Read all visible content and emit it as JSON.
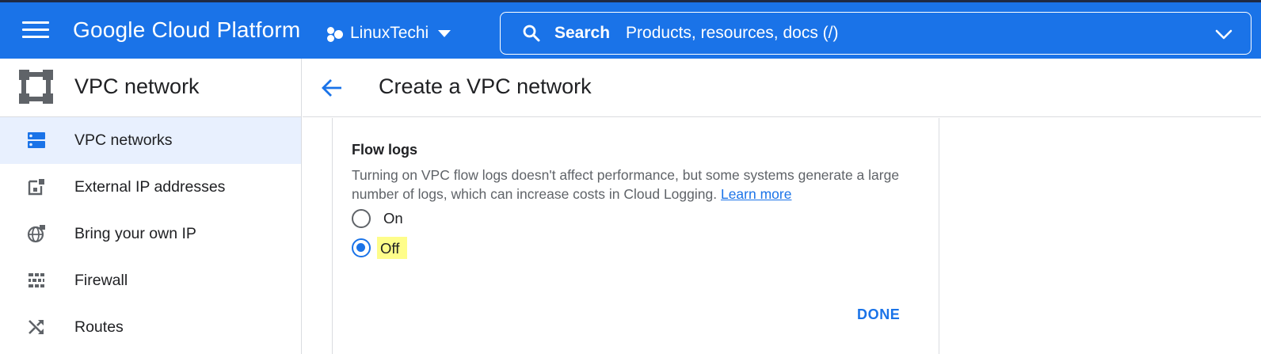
{
  "topbar": {
    "brand": "Google Cloud Platform",
    "project_name": "LinuxTechi",
    "search_label": "Search",
    "search_placeholder": "Products, resources, docs (/)"
  },
  "sidebar": {
    "title": "VPC network",
    "items": [
      {
        "label": "VPC networks",
        "icon": "vpc-networks-icon",
        "active": true
      },
      {
        "label": "External IP addresses",
        "icon": "external-ip-icon",
        "active": false
      },
      {
        "label": "Bring your own IP",
        "icon": "globe-icon",
        "active": false
      },
      {
        "label": "Firewall",
        "icon": "firewall-icon",
        "active": false
      },
      {
        "label": "Routes",
        "icon": "routes-icon",
        "active": false
      }
    ]
  },
  "main": {
    "page_title": "Create a VPC network",
    "flow_logs": {
      "title": "Flow logs",
      "description": "Turning on VPC flow logs doesn't affect performance, but some systems generate a large number of logs, which can increase costs in Cloud Logging.",
      "learn_more": "Learn more",
      "options": [
        {
          "label": "On",
          "checked": false
        },
        {
          "label": "Off",
          "checked": true
        }
      ],
      "done_label": "DONE"
    }
  },
  "colors": {
    "accent": "#1a73e8",
    "active_nav_bg": "#e8f0fe",
    "highlight": "#fefd8a"
  }
}
